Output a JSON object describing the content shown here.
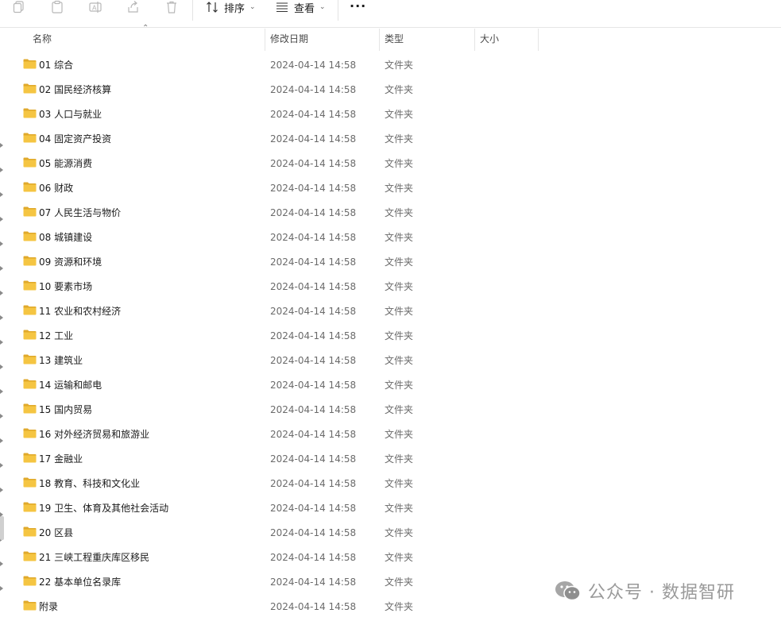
{
  "toolbar": {
    "icons": [
      "copy-icon",
      "paste-icon",
      "rename-icon",
      "share-icon",
      "delete-icon"
    ],
    "sort_label": "排序",
    "view_label": "查看",
    "more_label": "···"
  },
  "columns": {
    "name": "名称",
    "modified": "修改日期",
    "type": "类型",
    "size": "大小"
  },
  "files": [
    {
      "name": "01 综合",
      "modified": "2024-04-14 14:58",
      "type": "文件夹"
    },
    {
      "name": "02 国民经济核算",
      "modified": "2024-04-14 14:58",
      "type": "文件夹"
    },
    {
      "name": "03 人口与就业",
      "modified": "2024-04-14 14:58",
      "type": "文件夹"
    },
    {
      "name": "04 固定资产投资",
      "modified": "2024-04-14 14:58",
      "type": "文件夹"
    },
    {
      "name": "05 能源消费",
      "modified": "2024-04-14 14:58",
      "type": "文件夹"
    },
    {
      "name": "06 财政",
      "modified": "2024-04-14 14:58",
      "type": "文件夹"
    },
    {
      "name": "07 人民生活与物价",
      "modified": "2024-04-14 14:58",
      "type": "文件夹"
    },
    {
      "name": "08 城镇建设",
      "modified": "2024-04-14 14:58",
      "type": "文件夹"
    },
    {
      "name": "09 资源和环境",
      "modified": "2024-04-14 14:58",
      "type": "文件夹"
    },
    {
      "name": "10 要素市场",
      "modified": "2024-04-14 14:58",
      "type": "文件夹"
    },
    {
      "name": "11 农业和农村经济",
      "modified": "2024-04-14 14:58",
      "type": "文件夹"
    },
    {
      "name": "12 工业",
      "modified": "2024-04-14 14:58",
      "type": "文件夹"
    },
    {
      "name": "13 建筑业",
      "modified": "2024-04-14 14:58",
      "type": "文件夹"
    },
    {
      "name": "14 运输和邮电",
      "modified": "2024-04-14 14:58",
      "type": "文件夹"
    },
    {
      "name": "15 国内贸易",
      "modified": "2024-04-14 14:58",
      "type": "文件夹"
    },
    {
      "name": "16 对外经济贸易和旅游业",
      "modified": "2024-04-14 14:58",
      "type": "文件夹"
    },
    {
      "name": "17 金融业",
      "modified": "2024-04-14 14:58",
      "type": "文件夹"
    },
    {
      "name": "18 教育、科技和文化业",
      "modified": "2024-04-14 14:58",
      "type": "文件夹"
    },
    {
      "name": "19 卫生、体育及其他社会活动",
      "modified": "2024-04-14 14:58",
      "type": "文件夹"
    },
    {
      "name": "20 区县",
      "modified": "2024-04-14 14:58",
      "type": "文件夹"
    },
    {
      "name": "21 三峡工程重庆库区移民",
      "modified": "2024-04-14 14:58",
      "type": "文件夹"
    },
    {
      "name": "22 基本单位名录库",
      "modified": "2024-04-14 14:58",
      "type": "文件夹"
    },
    {
      "name": "附录",
      "modified": "2024-04-14 14:58",
      "type": "文件夹"
    }
  ],
  "watermark": {
    "text": "公众号 · 数据智研",
    "icon": "wechat-icon"
  },
  "colors": {
    "folder": "#F5C542",
    "folder_dark": "#E0A92B",
    "accent": "#0067C0"
  }
}
